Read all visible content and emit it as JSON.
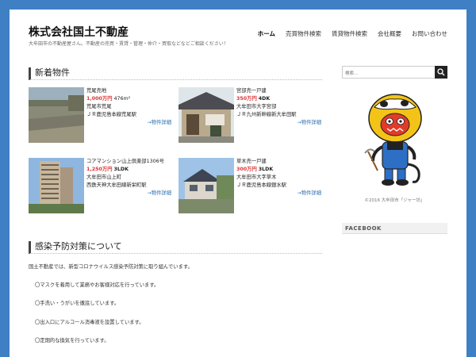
{
  "site": {
    "title": "株式会社国土不動産",
    "tagline": "大牟田市の不動産屋さん。不動産の売買・賃貸・管理・仲介・買取などなどご相談ください！"
  },
  "nav": [
    {
      "label": "ホーム",
      "active": true
    },
    {
      "label": "売買物件検索"
    },
    {
      "label": "賃貸物件検索"
    },
    {
      "label": "会社概要"
    },
    {
      "label": "お問い合わせ"
    }
  ],
  "new_listings": {
    "heading": "新着物件",
    "items": [
      {
        "name": "荒尾売地",
        "price": "1,000万円",
        "spec": "476m²",
        "address": "荒尾市荒尾",
        "station": "ＪＲ鹿児島本線荒尾駅",
        "link": "→物件詳細"
      },
      {
        "name": "宮部売一戸建",
        "price": "350万円",
        "spec": "4DK",
        "address": "大牟田市大字宮部",
        "station": "ＪＲ九州新幹線新大牟田駅",
        "link": "→物件詳細"
      },
      {
        "name": "コアマンション山上倶楽部1306号",
        "price": "1,250万円",
        "spec": "3LDK",
        "address": "大牟田市山上町",
        "station": "西鉄天神大牟田線新栄町駅",
        "link": "→物件詳細"
      },
      {
        "name": "草木売一戸建",
        "price": "300万円",
        "spec": "3LDK",
        "address": "大牟田市大字草木",
        "station": "ＪＲ鹿児島本線銀水駅",
        "link": "→物件詳細"
      }
    ]
  },
  "covid": {
    "heading": "感染予防対策について",
    "intro": "国土不動産では、新型コロナウイルス感染予防対策に取り組んでいます。",
    "points": [
      "〇マスクを着用して業務やお客様対応を行っています。",
      "〇手洗い・うがいを徹底しています。",
      "〇出入口にアルコール消毒液を設置しています。",
      "〇定期的な換気を行っています。"
    ]
  },
  "sidebar": {
    "search_placeholder": "検索...",
    "mascot_caption": "©2016 大牟田市「ジャー坊」",
    "facebook_heading": "FACEBOOK"
  },
  "colors": {
    "background_frame": "#3f7fc4",
    "price_red": "#d33333",
    "link_blue": "#2a6fb0"
  }
}
